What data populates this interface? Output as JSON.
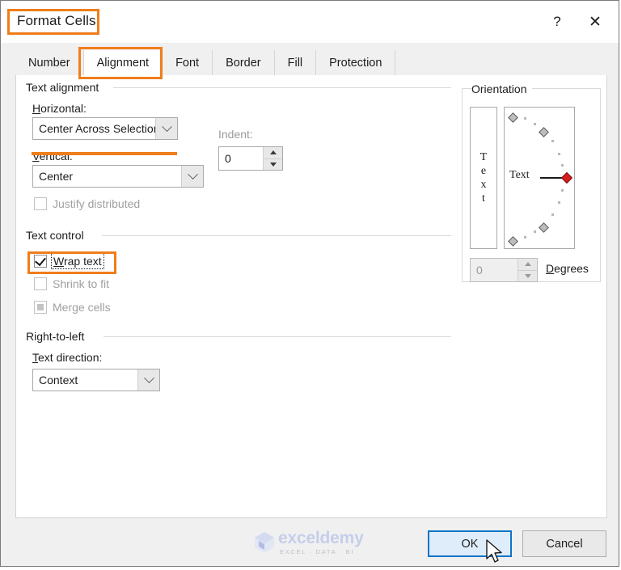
{
  "window": {
    "title": "Format Cells",
    "help_label": "?",
    "close_label": "✕"
  },
  "tabs": [
    {
      "label": "Number",
      "active": false
    },
    {
      "label": "Alignment",
      "active": true
    },
    {
      "label": "Font",
      "active": false
    },
    {
      "label": "Border",
      "active": false
    },
    {
      "label": "Fill",
      "active": false
    },
    {
      "label": "Protection",
      "active": false
    }
  ],
  "text_alignment": {
    "group_label": "Text alignment",
    "horizontal_label": "Horizontal:",
    "horizontal_value": "Center Across Selection",
    "vertical_label": "Vertical:",
    "vertical_value": "Center",
    "indent_label": "Indent:",
    "indent_value": "0",
    "justify_distributed_label": "Justify distributed",
    "justify_distributed_checked": false
  },
  "text_control": {
    "group_label": "Text control",
    "wrap_text_label": "Wrap text",
    "wrap_text_checked": true,
    "shrink_to_fit_label": "Shrink to fit",
    "shrink_to_fit_checked": false,
    "merge_cells_label": "Merge cells",
    "merge_cells_state": "mixed"
  },
  "right_to_left": {
    "group_label": "Right-to-left",
    "text_direction_label": "Text direction:",
    "text_direction_value": "Context"
  },
  "orientation": {
    "group_label": "Orientation",
    "vertical_text_letters": [
      "T",
      "e",
      "x",
      "t"
    ],
    "sample_text": "Text",
    "degrees_value": "0",
    "degrees_label": "Degrees"
  },
  "footer": {
    "watermark_name": "exceldemy",
    "watermark_tagline": "EXCEL · DATA · BI",
    "ok_label": "OK",
    "cancel_label": "Cancel"
  },
  "colors": {
    "annotation_orange": "#f07d1b",
    "focus_blue": "#0d74c8",
    "handle_red": "#d61d1d",
    "watermark_blue": "#c3cdeb"
  }
}
